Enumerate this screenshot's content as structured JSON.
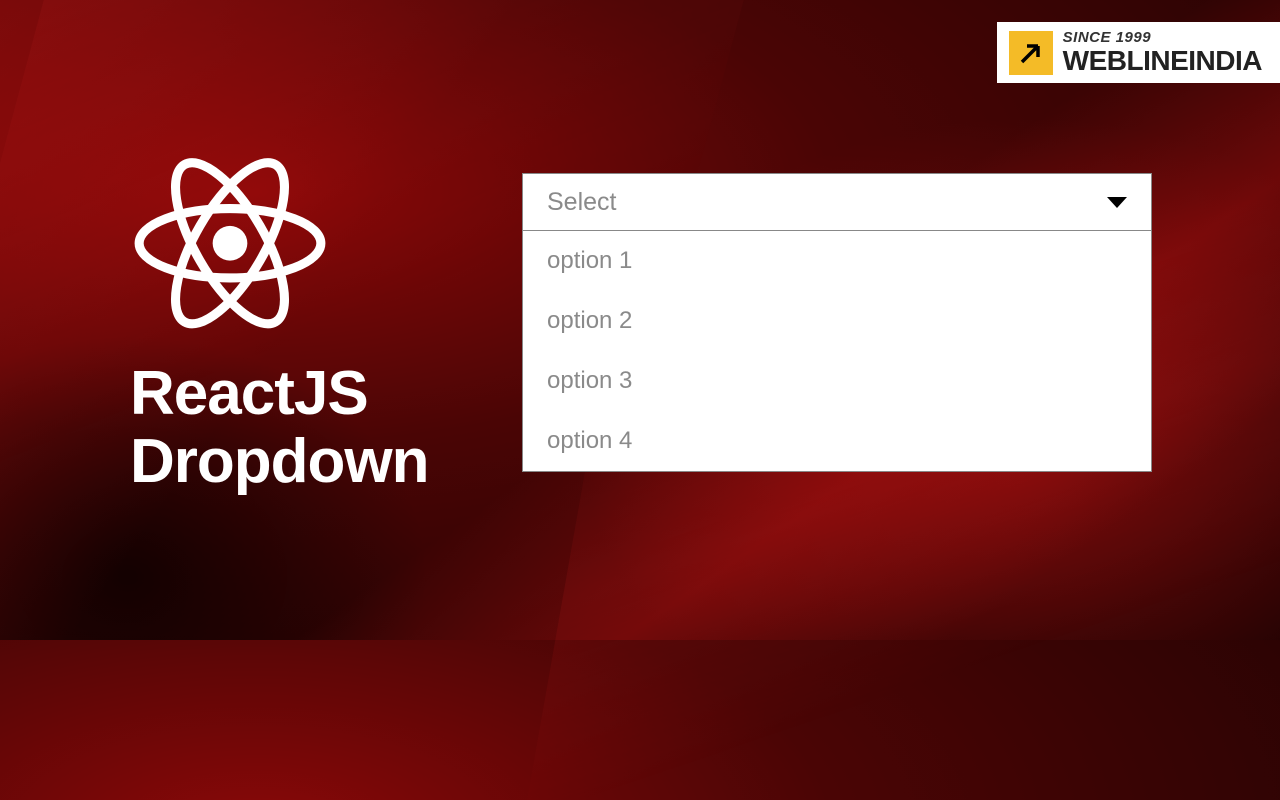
{
  "badge": {
    "since": "SINCE 1999",
    "brand": "WEBLINEINDIA"
  },
  "title": {
    "line1": "ReactJS",
    "line2": "Dropdown"
  },
  "dropdown": {
    "placeholder": "Select",
    "options": [
      "option 1",
      "option 2",
      "option 3",
      "option 4"
    ]
  }
}
